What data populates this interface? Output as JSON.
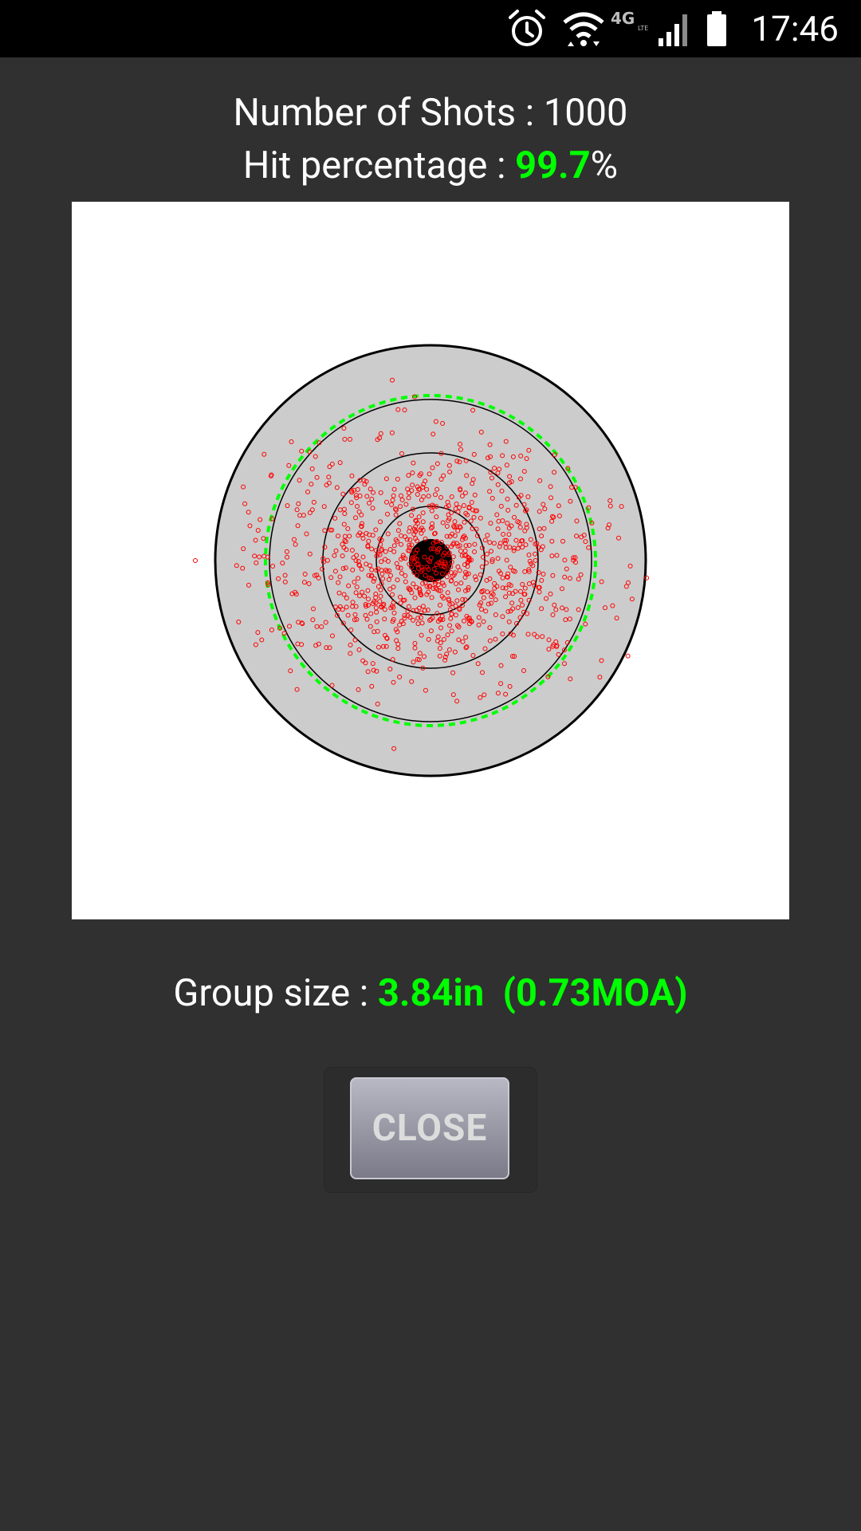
{
  "status_bar": {
    "time": "17:46",
    "network": "4G",
    "network_sub": "LTE",
    "icons": [
      "alarm-icon",
      "wifi-icon",
      "network-4g-lte-icon",
      "cell-signal-icon",
      "battery-icon"
    ]
  },
  "stats": {
    "shots_label": "Number of Shots : ",
    "shots_value": "1000",
    "hit_label": "Hit percentage : ",
    "hit_value": "99.7",
    "hit_suffix": "%",
    "group_label": "Group size : ",
    "group_value": "3.84in  (0.73MOA)"
  },
  "colors": {
    "accent": "#00ff00",
    "shot_marker": "#ff0000",
    "target_fill": "#cccccc",
    "bull": "#000000",
    "background": "#303030",
    "panel": "#ffffff"
  },
  "target": {
    "ring_count": 5,
    "shots_drawn": 1000,
    "shots_outside": 3
  },
  "close_button": {
    "label": "CLOSE"
  }
}
